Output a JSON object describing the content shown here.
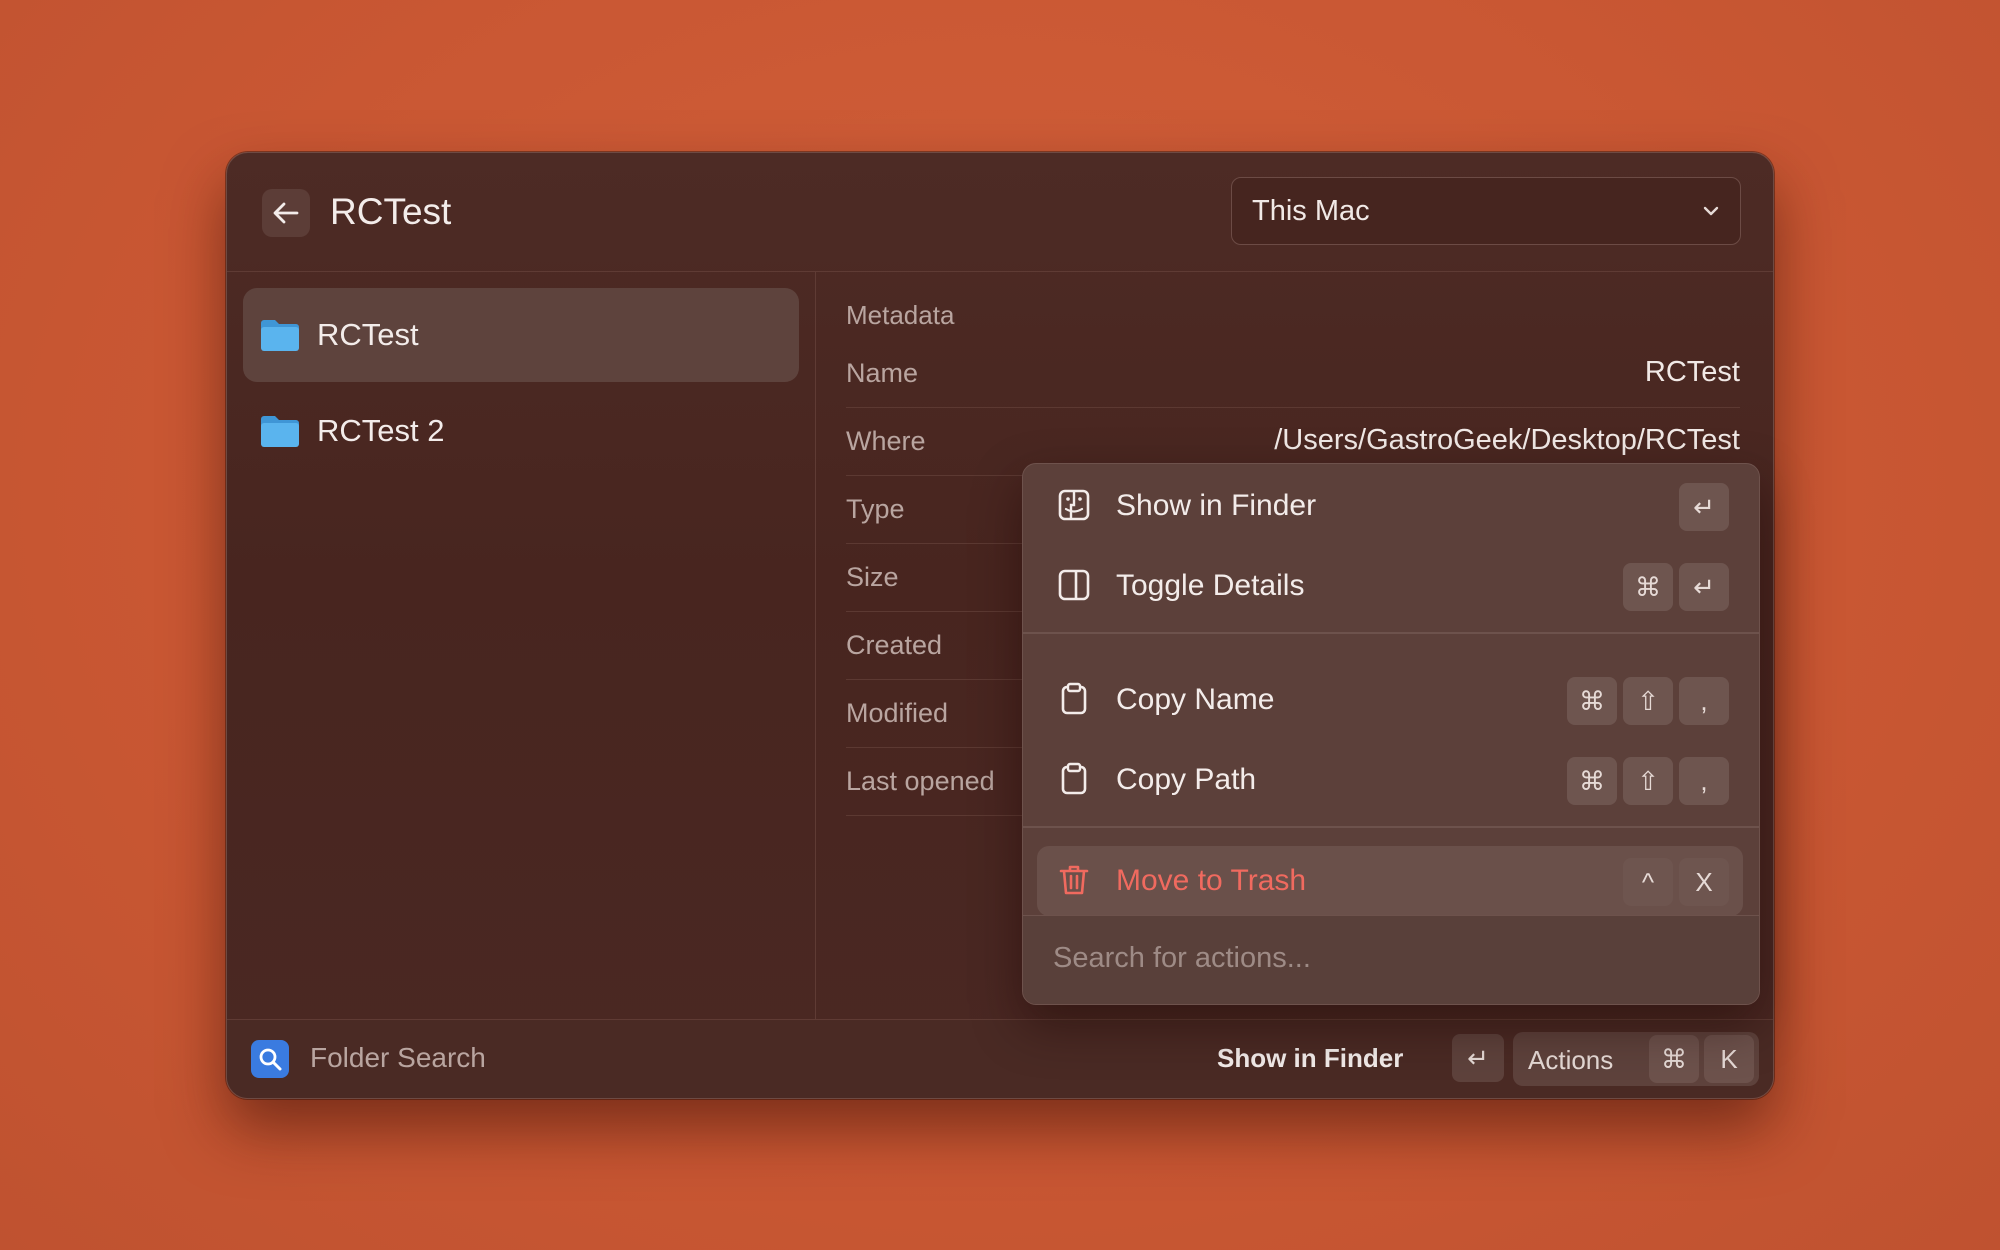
{
  "window": {
    "title": "RCTest",
    "scope_dropdown": {
      "selected": "This Mac"
    }
  },
  "list": {
    "items": [
      {
        "label": "RCTest",
        "selected": true
      },
      {
        "label": "RCTest 2",
        "selected": false
      }
    ]
  },
  "metadata": {
    "heading": "Metadata",
    "rows": [
      {
        "key": "Name",
        "value": "RCTest"
      },
      {
        "key": "Where",
        "value": "/Users/GastroGeek/Desktop/RCTest"
      },
      {
        "key": "Type",
        "value": ""
      },
      {
        "key": "Size",
        "value": ""
      },
      {
        "key": "Created",
        "value": ""
      },
      {
        "key": "Modified",
        "value": ""
      },
      {
        "key": "Last opened",
        "value": ""
      }
    ]
  },
  "actions_panel": {
    "items": [
      {
        "label": "Show in Finder",
        "icon": "finder-icon",
        "keys": [
          "↵"
        ]
      },
      {
        "label": "Toggle Details",
        "icon": "sidebar-panel-icon",
        "keys": [
          "⌘",
          "↵"
        ]
      },
      {
        "label": "Copy Name",
        "icon": "clipboard-icon",
        "keys": [
          "⌘",
          "⇧",
          ","
        ]
      },
      {
        "label": "Copy Path",
        "icon": "clipboard-icon",
        "keys": [
          "⌘",
          "⇧",
          ","
        ]
      },
      {
        "label": "Move to Trash",
        "icon": "trash-icon",
        "keys": [
          "^",
          "X"
        ]
      }
    ],
    "search_placeholder": "Search for actions..."
  },
  "footer": {
    "command_name": "Folder Search",
    "primary_action": "Show in Finder",
    "primary_key": "↵",
    "actions_label": "Actions",
    "actions_keys": [
      "⌘",
      "K"
    ]
  },
  "colors": {
    "background": "#c95733",
    "window": "#48251f",
    "danger": "#f06a5f",
    "accent_blue": "#3a7be0",
    "folder_blue": "#5ab4ee"
  }
}
